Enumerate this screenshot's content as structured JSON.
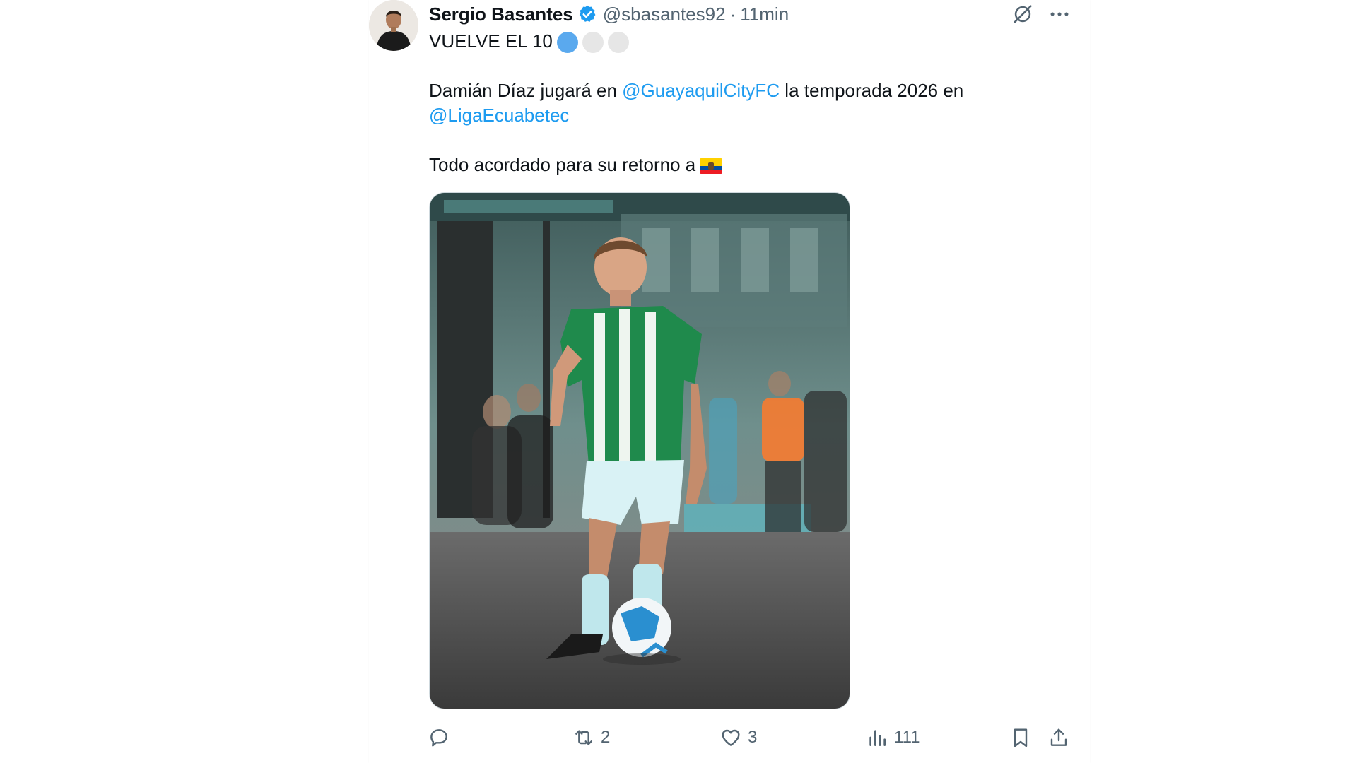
{
  "tweet": {
    "author": {
      "name": "Sergio Basantes",
      "handle": "@sbasantes92",
      "verified_icon": "verified-badge-icon",
      "avatar": "avatar"
    },
    "separator": "·",
    "time": "11min",
    "line1": "VUELVE EL 10",
    "line1_dots": [
      "#5aa9ee",
      "#e6e6e6",
      "#e6e6e6"
    ],
    "line2_prefix": "Damián Díaz jugará en",
    "mention1": "@GuayaquilCityFC",
    "line2_suffix": "la temporada 2026 en",
    "mention2": "@LigaEcuabetec",
    "line3": "Todo acordado para su retorno a",
    "line3_flag": "ecuador-flag",
    "media": {
      "image": "soccer-player-photo"
    },
    "stats": {
      "replies": "",
      "retweets": "2",
      "likes": "3",
      "views": "111"
    }
  },
  "colors": {
    "link": "#1d9bf0",
    "muted": "#536471",
    "verified": "#1d9bf0"
  }
}
